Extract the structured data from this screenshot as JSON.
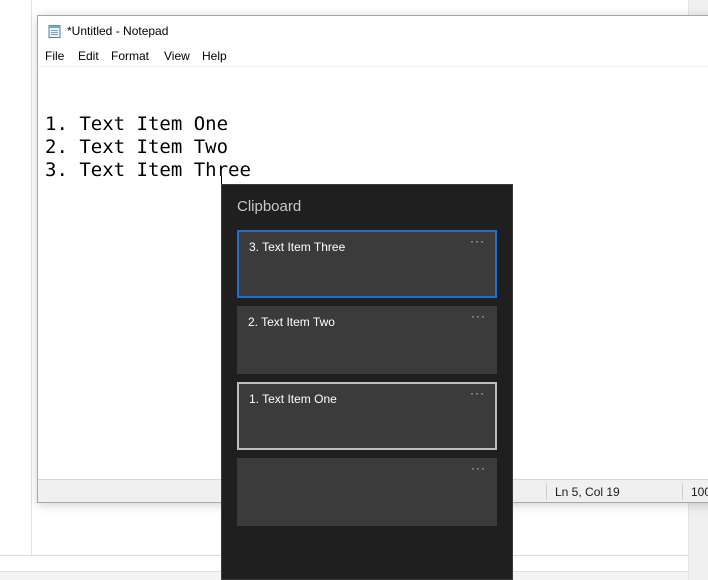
{
  "notepad": {
    "title": "*Untitled - Notepad",
    "menu": [
      "File",
      "Edit",
      "Format",
      "View",
      "Help"
    ],
    "lines": [
      "1. Text Item One",
      "2. Text Item Two",
      "3. Text Item Three"
    ],
    "status": {
      "position": "Ln 5, Col 19",
      "zoom": "100"
    }
  },
  "clipboard": {
    "title": "Clipboard",
    "items": [
      {
        "text": "3. Text Item Three",
        "state": "selected"
      },
      {
        "text": "2. Text Item Two",
        "state": "normal"
      },
      {
        "text": "1. Text Item One",
        "state": "focused"
      },
      {
        "text": "",
        "state": "normal"
      }
    ],
    "more_glyph": "···"
  },
  "colors": {
    "panel_bg": "#1f1f1f",
    "item_bg": "#3b3b3b",
    "selected_border": "#1e6fce",
    "focused_border": "#bdbdbd"
  }
}
